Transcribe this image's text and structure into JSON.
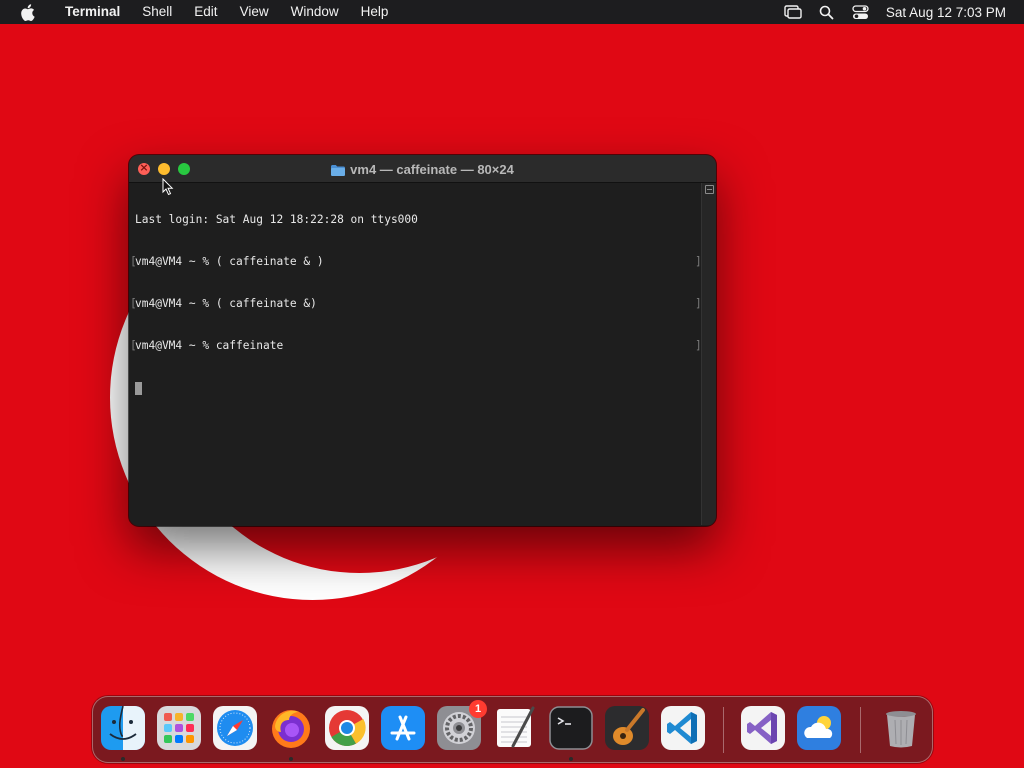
{
  "menubar": {
    "app_name": "Terminal",
    "items": [
      "Shell",
      "Edit",
      "View",
      "Window",
      "Help"
    ],
    "clock": "Sat Aug 12  7:03 PM"
  },
  "terminal": {
    "title": "vm4 — caffeinate — 80×24",
    "lines": [
      "Last login: Sat Aug 12 18:22:28 on ttys000",
      "vm4@VM4 ~ % ( caffeinate & )",
      "vm4@VM4 ~ % ( caffeinate &)",
      "vm4@VM4 ~ % caffeinate"
    ]
  },
  "dock": {
    "apps": [
      {
        "name": "Finder",
        "icon": "finder-icon",
        "running": true
      },
      {
        "name": "Launchpad",
        "icon": "launchpad-icon",
        "running": false
      },
      {
        "name": "Safari",
        "icon": "safari-icon",
        "running": false
      },
      {
        "name": "Firefox",
        "icon": "firefox-icon",
        "running": true
      },
      {
        "name": "Google Chrome",
        "icon": "chrome-icon",
        "running": false
      },
      {
        "name": "App Store",
        "icon": "app-store-icon",
        "running": false
      },
      {
        "name": "System Settings",
        "icon": "system-settings-icon",
        "running": false,
        "badge": "1"
      },
      {
        "name": "TextEdit",
        "icon": "textedit-icon",
        "running": false
      },
      {
        "name": "Terminal",
        "icon": "terminal-icon",
        "running": true
      },
      {
        "name": "GarageBand",
        "icon": "garageband-icon",
        "running": false
      },
      {
        "name": "Visual Studio Code",
        "icon": "vscode-icon",
        "running": false
      },
      {
        "name": "Visual Studio",
        "icon": "visual-studio-icon",
        "running": false
      },
      {
        "name": "Weather",
        "icon": "weather-icon",
        "running": false
      },
      {
        "name": "Trash",
        "icon": "trash-icon",
        "running": false
      }
    ]
  },
  "colors": {
    "wallpaper": "#e00814",
    "menubar": "#1d1d1f",
    "terminal_bg": "#1e1e1e",
    "close": "#ff5f57",
    "minimize": "#febc2e",
    "zoom": "#28c840"
  }
}
